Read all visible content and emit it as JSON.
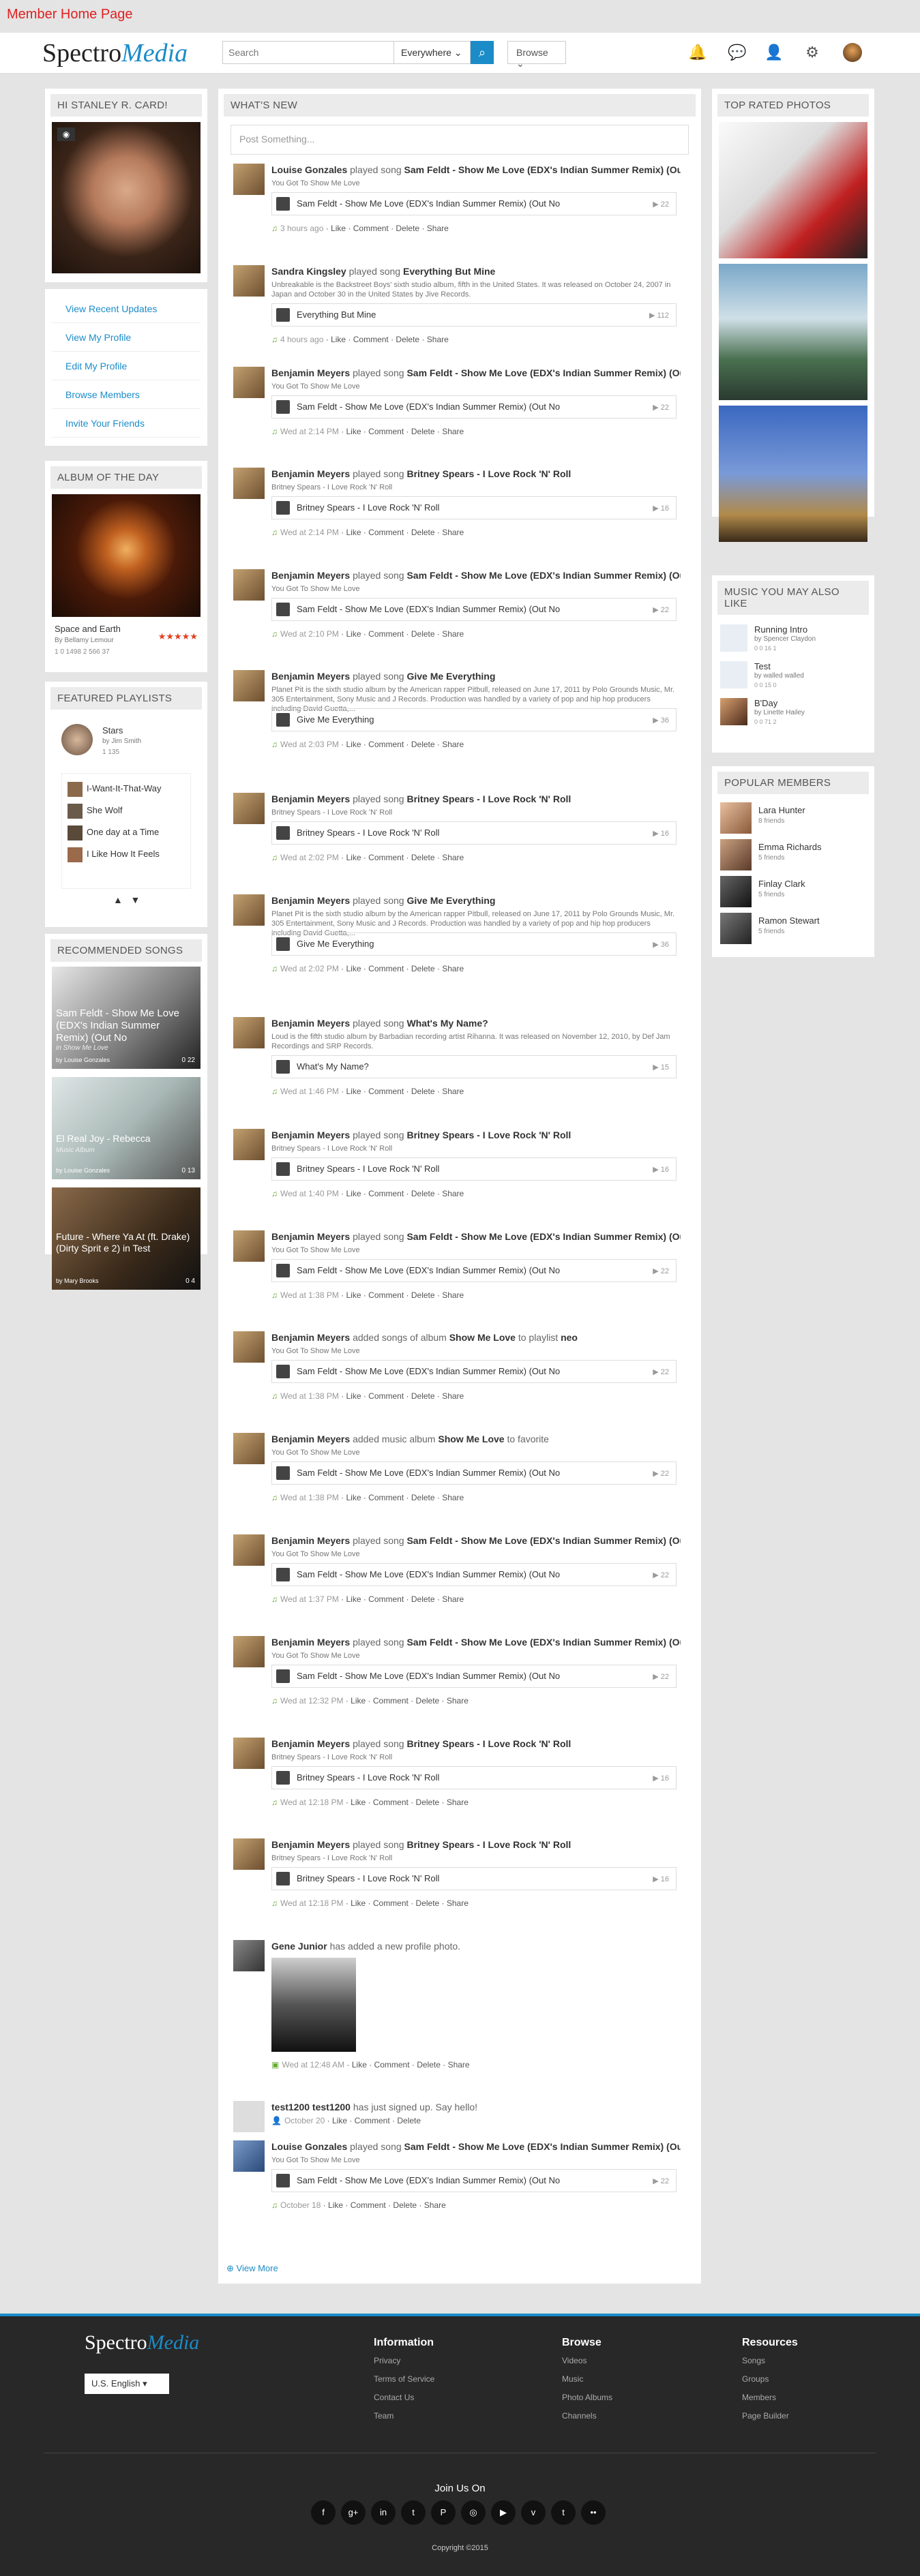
{
  "page_label": "Member Home Page",
  "header": {
    "logo_main": "Spectro",
    "logo_accent": "Media",
    "search_placeholder": "Search",
    "scope": "Everywhere",
    "browse": "Browse"
  },
  "profile": {
    "greeting": "HI STANLEY R. CARD!"
  },
  "nav": [
    "View Recent Updates",
    "View My Profile",
    "Edit My Profile",
    "Browse Members",
    "Invite Your Friends"
  ],
  "album": {
    "title": "ALBUM OF THE DAY",
    "name": "Space and Earth",
    "by": "By Bellamy Lemour",
    "stats": "1  0  1498  2  566  37"
  },
  "playlists": {
    "title": "FEATURED PLAYLISTS",
    "name": "Stars",
    "by": "by Jim Smith",
    "stats": "1  135",
    "items": [
      "I-Want-It-That-Way",
      "She Wolf",
      "One day at a Time",
      "I Like How It Feels"
    ]
  },
  "recommended": {
    "title": "RECOMMENDED SONGS",
    "items": [
      {
        "name": "Sam Feldt - Show Me Love (EDX's Indian Summer Remix) (Out No",
        "sub": "in Show Me Love",
        "by": "by Louise Gonzales",
        "stats": "0  22"
      },
      {
        "name": "El Real Joy - Rebecca",
        "sub": "Music Album",
        "by": "by Louise Gonzales",
        "stats": "0  13"
      },
      {
        "name": "Future - Where Ya At (ft. Drake) (Dirty Sprit e 2) in Test",
        "sub": "",
        "by": "by Mary Brooks",
        "stats": "0  4"
      }
    ]
  },
  "feed": {
    "title": "WHAT'S NEW",
    "post_placeholder": "Post Something...",
    "view_more": "View More",
    "items": [
      {
        "actor": "Louise Gonzales",
        "verb": "played song",
        "obj": "Sam Feldt - Show Me Love (EDX's Indian Summer Remix) (Out No",
        "desc": "You Got To Show Me Love",
        "track": "Sam Feldt - Show Me Love (EDX's Indian Summer Remix) (Out No",
        "count": "22",
        "time": "3 hours ago"
      },
      {
        "actor": "Sandra Kingsley",
        "verb": "played song",
        "obj": "Everything But Mine",
        "desc": "Unbreakable is the Backstreet Boys' sixth studio album, fifth in the United States. It was released on October 24, 2007 in Japan and October 30 in the United States by Jive Records.",
        "track": "Everything But Mine",
        "count": "112",
        "time": "4 hours ago"
      },
      {
        "actor": "Benjamin Meyers",
        "verb": "played song",
        "obj": "Sam Feldt - Show Me Love (EDX's Indian Summer Remix) (Out No",
        "desc": "You Got To Show Me Love",
        "track": "Sam Feldt - Show Me Love (EDX's Indian Summer Remix) (Out No",
        "count": "22",
        "time": "Wed at 2:14 PM"
      },
      {
        "actor": "Benjamin Meyers",
        "verb": "played song",
        "obj": "Britney Spears - I Love Rock 'N' Roll",
        "desc": "Britney Spears - I Love Rock 'N' Roll",
        "track": "Britney Spears - I Love Rock 'N' Roll",
        "count": "16",
        "time": "Wed at 2:14 PM"
      },
      {
        "actor": "Benjamin Meyers",
        "verb": "played song",
        "obj": "Sam Feldt - Show Me Love (EDX's Indian Summer Remix) (Out No",
        "desc": "You Got To Show Me Love",
        "track": "Sam Feldt - Show Me Love (EDX's Indian Summer Remix) (Out No",
        "count": "22",
        "time": "Wed at 2:10 PM"
      },
      {
        "actor": "Benjamin Meyers",
        "verb": "played song",
        "obj": "Give Me Everything",
        "desc": "Planet Pit is the sixth studio album by the American rapper Pitbull, released on June 17, 2011 by Polo Grounds Music, Mr. 305 Entertainment, Sony Music and J Records. Production was handled by a variety of pop and hip hop producers including David Guetta,...",
        "track": "Give Me Everything",
        "count": "36",
        "time": "Wed at 2:03 PM"
      },
      {
        "actor": "Benjamin Meyers",
        "verb": "played song",
        "obj": "Britney Spears - I Love Rock 'N' Roll",
        "desc": "Britney Spears - I Love Rock 'N' Roll",
        "track": "Britney Spears - I Love Rock 'N' Roll",
        "count": "16",
        "time": "Wed at 2:02 PM"
      },
      {
        "actor": "Benjamin Meyers",
        "verb": "played song",
        "obj": "Give Me Everything",
        "desc": "Planet Pit is the sixth studio album by the American rapper Pitbull, released on June 17, 2011 by Polo Grounds Music, Mr. 305 Entertainment, Sony Music and J Records. Production was handled by a variety of pop and hip hop producers including David Guetta,...",
        "track": "Give Me Everything",
        "count": "36",
        "time": "Wed at 2:02 PM"
      },
      {
        "actor": "Benjamin Meyers",
        "verb": "played song",
        "obj": "What's My Name?",
        "desc": "Loud is the fifth studio album by Barbadian recording artist Rihanna. It was released on November 12, 2010, by Def Jam Recordings and SRP Records.",
        "track": "What's My Name?",
        "count": "15",
        "time": "Wed at 1:46 PM"
      },
      {
        "actor": "Benjamin Meyers",
        "verb": "played song",
        "obj": "Britney Spears - I Love Rock 'N' Roll",
        "desc": "Britney Spears - I Love Rock 'N' Roll",
        "track": "Britney Spears - I Love Rock 'N' Roll",
        "count": "16",
        "time": "Wed at 1:40 PM"
      },
      {
        "actor": "Benjamin Meyers",
        "verb": "played song",
        "obj": "Sam Feldt - Show Me Love (EDX's Indian Summer Remix) (Out No",
        "desc": "You Got To Show Me Love",
        "track": "Sam Feldt - Show Me Love (EDX's Indian Summer Remix) (Out No",
        "count": "22",
        "time": "Wed at 1:38 PM"
      },
      {
        "actor": "Benjamin Meyers",
        "verb": "added songs of album",
        "obj": "Show Me Love",
        "extra": " to playlist ",
        "extra2": "neo",
        "desc": "You Got To Show Me Love",
        "track": "Sam Feldt - Show Me Love (EDX's Indian Summer Remix) (Out No",
        "count": "22",
        "time": "Wed at 1:38 PM"
      },
      {
        "actor": "Benjamin Meyers",
        "verb": "added music album",
        "obj": "Show Me Love",
        "extra": " to favorite",
        "extra2": "",
        "desc": "You Got To Show Me Love",
        "track": "Sam Feldt - Show Me Love (EDX's Indian Summer Remix) (Out No",
        "count": "22",
        "time": "Wed at 1:38 PM"
      },
      {
        "actor": "Benjamin Meyers",
        "verb": "played song",
        "obj": "Sam Feldt - Show Me Love (EDX's Indian Summer Remix) (Out No",
        "desc": "You Got To Show Me Love",
        "track": "Sam Feldt - Show Me Love (EDX's Indian Summer Remix) (Out No",
        "count": "22",
        "time": "Wed at 1:37 PM"
      },
      {
        "actor": "Benjamin Meyers",
        "verb": "played song",
        "obj": "Sam Feldt - Show Me Love (EDX's Indian Summer Remix) (Out No",
        "desc": "You Got To Show Me Love",
        "track": "Sam Feldt - Show Me Love (EDX's Indian Summer Remix) (Out No",
        "count": "22",
        "time": "Wed at 12:32 PM"
      },
      {
        "actor": "Benjamin Meyers",
        "verb": "played song",
        "obj": "Britney Spears - I Love Rock 'N' Roll",
        "desc": "Britney Spears - I Love Rock 'N' Roll",
        "track": "Britney Spears - I Love Rock 'N' Roll",
        "count": "16",
        "time": "Wed at 12:18 PM"
      },
      {
        "actor": "Benjamin Meyers",
        "verb": "played song",
        "obj": "Britney Spears - I Love Rock 'N' Roll",
        "desc": "Britney Spears - I Love Rock 'N' Roll",
        "track": "Britney Spears - I Love Rock 'N' Roll",
        "count": "16",
        "time": "Wed at 12:18 PM"
      }
    ],
    "photo_post": {
      "actor": "Gene Junior",
      "verb": "has added a new profile photo.",
      "time": "Wed at 12:48 AM"
    },
    "signup": {
      "actor": "test1200 test1200",
      "verb": "has just signed up. Say hello!",
      "time": "October 20"
    },
    "last": {
      "actor": "Louise Gonzales",
      "verb": "played song",
      "obj": "Sam Feldt - Show Me Love (EDX's Indian Summer Remix) (Out No",
      "desc": "You Got To Show Me Love",
      "track": "Sam Feldt - Show Me Love (EDX's Indian Summer Remix) (Out No",
      "count": "22",
      "time": "October 18"
    },
    "actions": "Like · Comment · Delete · Share",
    "signup_actions": "Like · Comment · Delete"
  },
  "right": {
    "photos_title": "TOP RATED PHOTOS",
    "music_title": "MUSIC YOU MAY ALSO LIKE",
    "music": [
      {
        "name": "Running Intro",
        "by": "by Spencer Claydon",
        "stats": "0  0  16  1"
      },
      {
        "name": "Test",
        "by": "by walled walled",
        "stats": "0  0  15  0"
      },
      {
        "name": "B'Day",
        "by": "by Linette Hailey",
        "stats": "0  0  71  2"
      }
    ],
    "members_title": "POPULAR MEMBERS",
    "members": [
      {
        "name": "Lara Hunter",
        "friends": "8 friends"
      },
      {
        "name": "Emma Richards",
        "friends": "5 friends"
      },
      {
        "name": "Finlay Clark",
        "friends": "5 friends"
      },
      {
        "name": "Ramon Stewart",
        "friends": "5 friends"
      }
    ]
  },
  "footer": {
    "logo_main": "Spectro",
    "logo_accent": "Media",
    "language": "U.S. English",
    "cols": [
      {
        "title": "Information",
        "items": [
          "Privacy",
          "Terms of Service",
          "Contact Us",
          "Team"
        ]
      },
      {
        "title": "Browse",
        "items": [
          "Videos",
          "Music",
          "Photo Albums",
          "Channels"
        ]
      },
      {
        "title": "Resources",
        "items": [
          "Songs",
          "Groups",
          "Members",
          "Page Builder"
        ]
      }
    ],
    "join": "Join Us On",
    "copyright": "Copyright ©2015"
  }
}
